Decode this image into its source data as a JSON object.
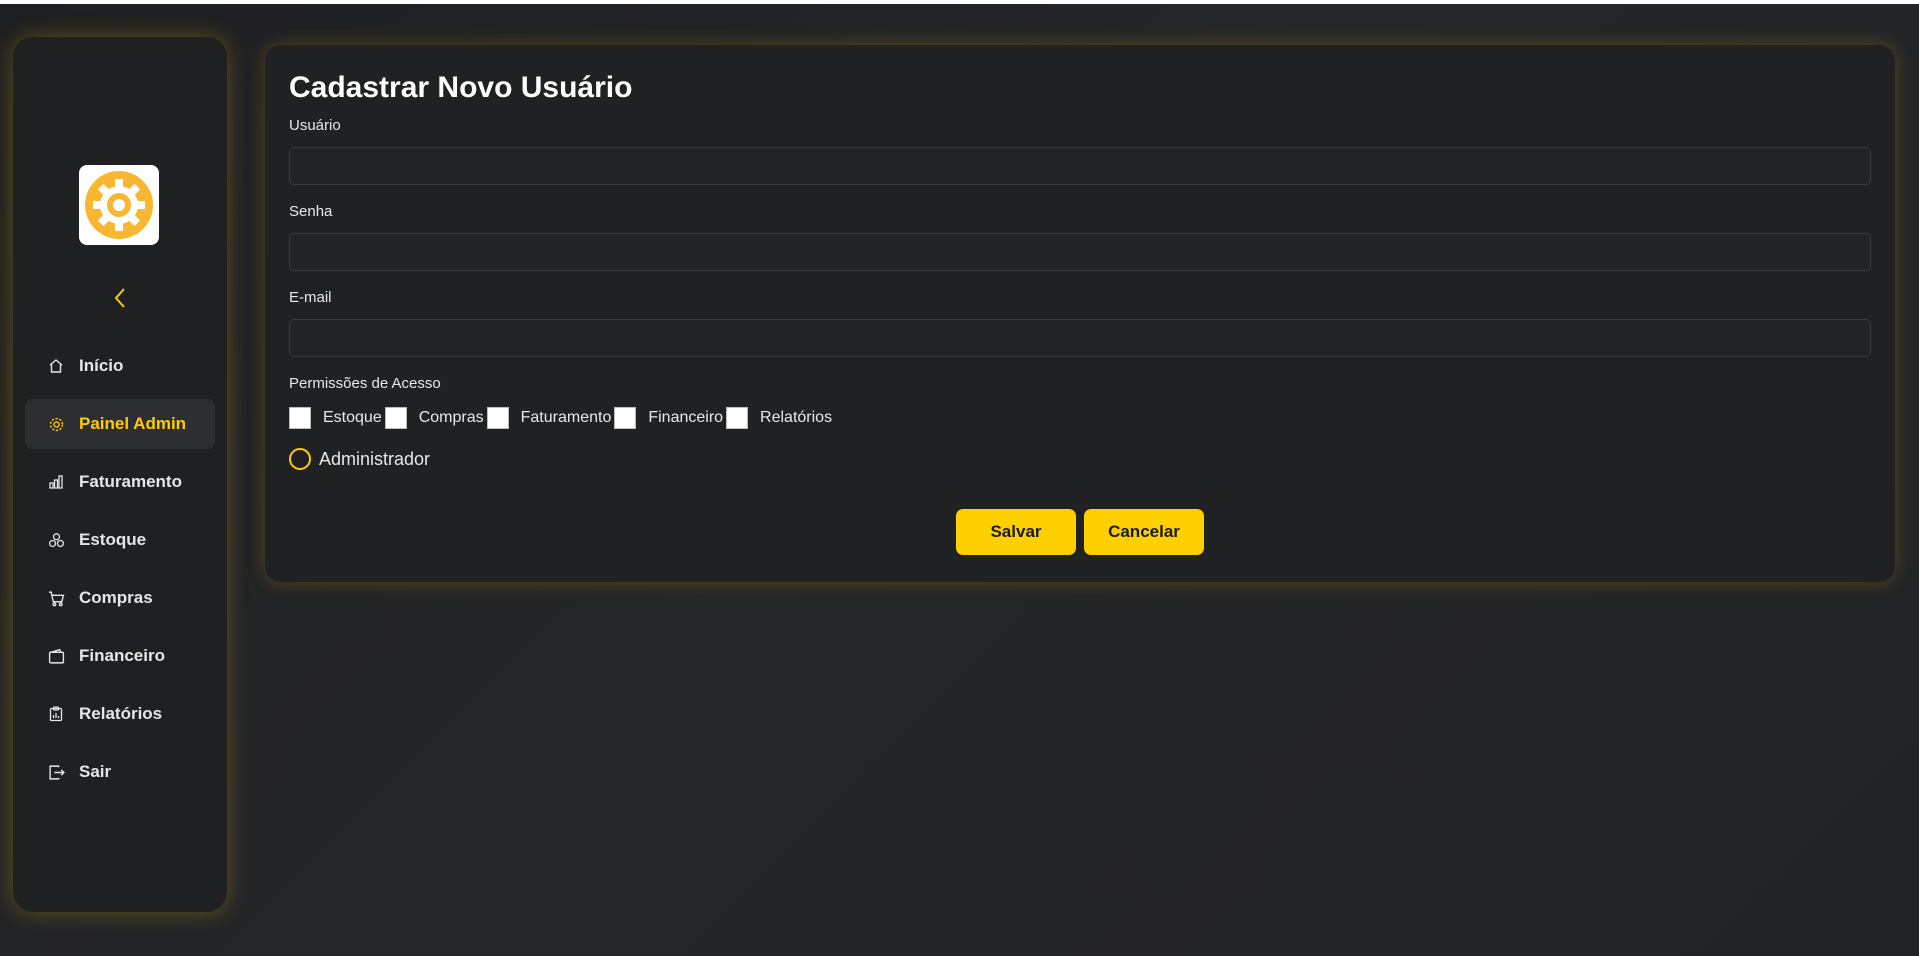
{
  "colors": {
    "accent": "#ffcc00",
    "background": "#232426",
    "panel": "#202123",
    "active_item_bg": "#2d2e31"
  },
  "sidebar": {
    "logo_icon": "gear-icon",
    "collapse_icon": "chevron-left-icon",
    "items": [
      {
        "label": "Início",
        "icon": "home-icon",
        "active": false
      },
      {
        "label": "Painel Admin",
        "icon": "gear-icon",
        "active": true
      },
      {
        "label": "Faturamento",
        "icon": "bar-chart-icon",
        "active": false
      },
      {
        "label": "Estoque",
        "icon": "boxes-icon",
        "active": false
      },
      {
        "label": "Compras",
        "icon": "cart-icon",
        "active": false
      },
      {
        "label": "Financeiro",
        "icon": "wallet-icon",
        "active": false
      },
      {
        "label": "Relatórios",
        "icon": "report-icon",
        "active": false
      },
      {
        "label": "Sair",
        "icon": "logout-icon",
        "active": false
      }
    ]
  },
  "form": {
    "title": "Cadastrar Novo Usuário",
    "username_label": "Usuário",
    "username_value": "",
    "password_label": "Senha",
    "password_value": "",
    "email_label": "E-mail",
    "email_value": "",
    "permissions_label": "Permissões de Acesso",
    "permissions": [
      {
        "label": "Estoque",
        "checked": false
      },
      {
        "label": "Compras",
        "checked": false
      },
      {
        "label": "Faturamento",
        "checked": false
      },
      {
        "label": "Financeiro",
        "checked": false
      },
      {
        "label": "Relatórios",
        "checked": false
      }
    ],
    "admin_label": "Administrador",
    "admin_selected": false,
    "save_label": "Salvar",
    "cancel_label": "Cancelar"
  }
}
